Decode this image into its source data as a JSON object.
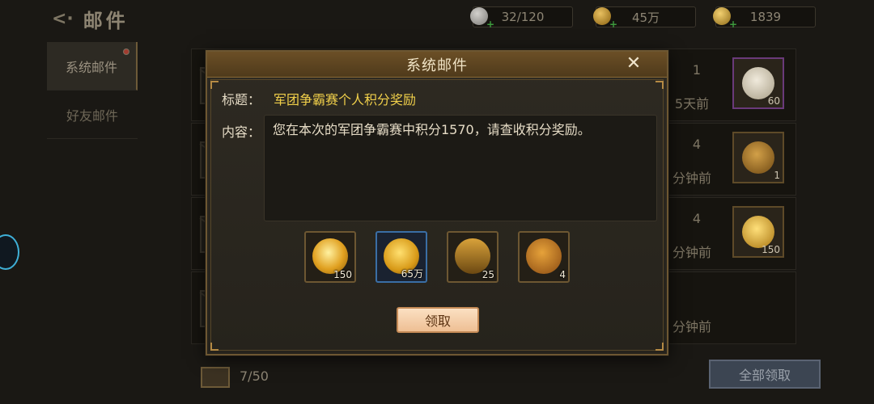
{
  "header": {
    "back_icon": "back-arrow-icon",
    "title": "邮件"
  },
  "resources": [
    {
      "icon": "stone-icon",
      "value": "32/120"
    },
    {
      "icon": "coin-icon",
      "value": "45万"
    },
    {
      "icon": "gold-ingot-icon",
      "value": "1839"
    }
  ],
  "tabs": [
    {
      "label": "系统邮件",
      "active": true,
      "has_notification": true
    },
    {
      "label": "好友邮件",
      "active": false
    }
  ],
  "mail_rows": [
    {
      "count": "1",
      "time": "5天前",
      "item_count": "60",
      "item_icon": "steamed-bun-icon"
    },
    {
      "count": "4",
      "time": "分钟前",
      "item_count": "1",
      "item_icon": "title-badge-icon"
    },
    {
      "count": "4",
      "time": "分钟前",
      "item_count": "150",
      "item_icon": "gold-ingot-icon"
    },
    {
      "count": "",
      "time": "分钟前",
      "item_count": "",
      "item_icon": ""
    }
  ],
  "footer": {
    "mail_count": "7/50",
    "claim_all_label": "全部领取"
  },
  "dialog": {
    "title": "系统邮件",
    "close_label": "✕",
    "subject_label": "标题：",
    "subject": "军团争霸赛个人积分奖励",
    "content_label": "内容：",
    "content": "您在本次的军团争霸赛中积分1570，请查收积分奖励。",
    "rewards": [
      {
        "icon": "gold-ingot-icon",
        "count": "150"
      },
      {
        "icon": "gold-coin-icon",
        "count": "65万"
      },
      {
        "icon": "treasure-chest-icon",
        "count": "25"
      },
      {
        "icon": "token-icon",
        "count": "4"
      }
    ],
    "claim_label": "领取"
  }
}
